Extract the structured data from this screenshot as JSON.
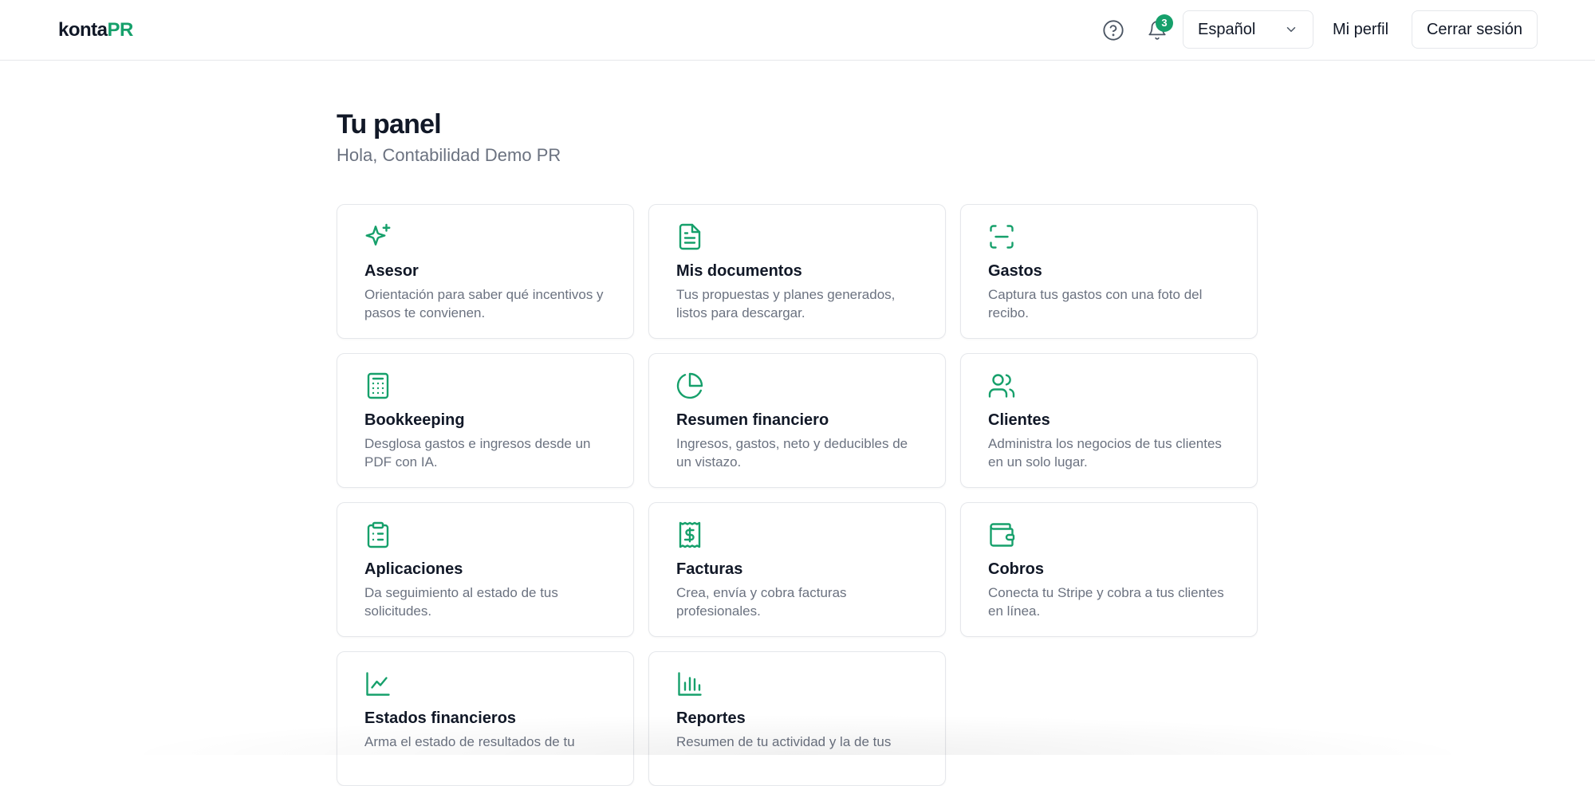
{
  "header": {
    "logo_main": "konta",
    "logo_accent": "PR",
    "help_icon": "help-circle-icon",
    "bell_icon": "bell-icon",
    "notification_count": "3",
    "language": "Español",
    "profile_label": "Mi perfil",
    "logout_label": "Cerrar sesión"
  },
  "main": {
    "title": "Tu panel",
    "greeting": "Hola, Contabilidad Demo PR"
  },
  "cards": [
    {
      "icon": "sparkles-icon",
      "title": "Asesor",
      "desc": "Orientación para saber qué incentivos y pasos te convienen."
    },
    {
      "icon": "document-icon",
      "title": "Mis documentos",
      "desc": "Tus propuestas y planes generados, listos para descargar."
    },
    {
      "icon": "scan-icon",
      "title": "Gastos",
      "desc": "Captura tus gastos con una foto del recibo."
    },
    {
      "icon": "calculator-icon",
      "title": "Bookkeeping",
      "desc": "Desglosa gastos e ingresos desde un PDF con IA."
    },
    {
      "icon": "pie-chart-icon",
      "title": "Resumen financiero",
      "desc": "Ingresos, gastos, neto y deducibles de un vistazo."
    },
    {
      "icon": "users-icon",
      "title": "Clientes",
      "desc": "Administra los negocios de tus clientes en un solo lugar."
    },
    {
      "icon": "clipboard-icon",
      "title": "Aplicaciones",
      "desc": "Da seguimiento al estado de tus solicitudes."
    },
    {
      "icon": "receipt-dollar-icon",
      "title": "Facturas",
      "desc": "Crea, envía y cobra facturas profesionales."
    },
    {
      "icon": "wallet-icon",
      "title": "Cobros",
      "desc": "Conecta tu Stripe y cobra a tus clientes en línea."
    },
    {
      "icon": "line-chart-icon",
      "title": "Estados financieros",
      "desc": "Arma el estado de resultados de tu"
    },
    {
      "icon": "bar-chart-icon",
      "title": "Reportes",
      "desc": "Resumen de tu actividad y la de tus"
    }
  ],
  "colors": {
    "accent": "#16a06b",
    "muted_text": "#6b7280",
    "border": "#e5e7eb"
  }
}
